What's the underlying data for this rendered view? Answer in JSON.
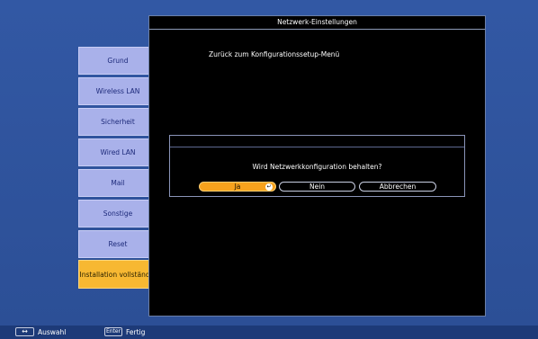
{
  "panel": {
    "title": "Netzwerk-Einstellungen",
    "subtitle": "Zurück zum Konfigurationssetup-Menü"
  },
  "sidebar": {
    "items": [
      {
        "label": "Grund",
        "active": false
      },
      {
        "label": "Wireless LAN",
        "active": false
      },
      {
        "label": "Sicherheit",
        "active": false
      },
      {
        "label": "Wired LAN",
        "active": false
      },
      {
        "label": "Mail",
        "active": false
      },
      {
        "label": "Sonstige",
        "active": false
      },
      {
        "label": "Reset",
        "active": false
      },
      {
        "label": "Installation vollständig",
        "active": true
      }
    ]
  },
  "dialog": {
    "message": "Wird Netzwerkkonfiguration behalten?",
    "yes_label": "Ja",
    "no_label": "Nein",
    "cancel_label": "Abbrechen",
    "enter_icon": "enter-icon"
  },
  "bottombar": {
    "nav_key": "↔",
    "nav_label": "Auswahl",
    "enter_key": "Enter",
    "enter_label": "Fertig"
  },
  "colors": {
    "background": "#2c4f96",
    "sidebar_button": "#a9b1ea",
    "active_button": "#f7b832",
    "selected_dialog_button": "#f7a21d"
  }
}
